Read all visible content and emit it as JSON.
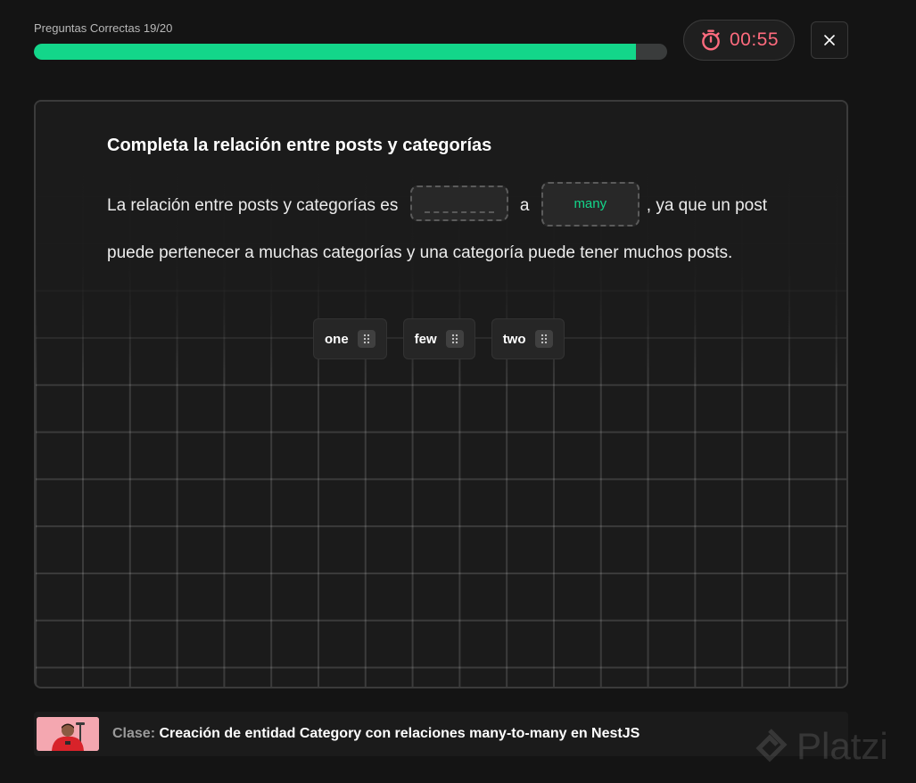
{
  "progress": {
    "label": "Preguntas Correctas 19/20",
    "percent": 95
  },
  "timer": {
    "value": "00:55",
    "color": "#ff6b7e",
    "icon": "stopwatch-icon"
  },
  "close": {
    "icon": "close-icon"
  },
  "question": {
    "title": "Completa la relación entre posts y categorías",
    "before_blank": "La relación entre posts y categorías es",
    "connector": "a",
    "filled_value": "many",
    "after_blank": ", ya que un post puede pertenecer a muchas categorías y una categoría puede tener muchos posts."
  },
  "options": [
    {
      "label": "one"
    },
    {
      "label": "few"
    },
    {
      "label": "two"
    }
  ],
  "class_info": {
    "prefix": "Clase:",
    "title": "Creación de entidad Category con relaciones many-to-many en NestJS"
  },
  "watermark": {
    "text": "Platzi"
  },
  "colors": {
    "accent": "#13d68a",
    "timer": "#ff6b7e",
    "background": "#141414"
  }
}
